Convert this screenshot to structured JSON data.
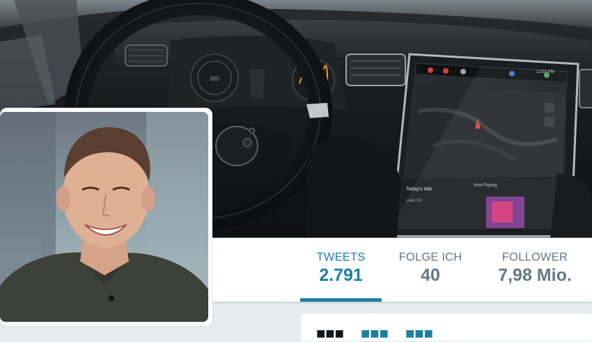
{
  "profile": {
    "avatar_alt": "",
    "header_image": "tesla-model-s-dashboard"
  },
  "nav": {
    "stats": [
      {
        "label": "TWEETS",
        "value": "2.791",
        "active": true
      },
      {
        "label": "FOLGE ICH",
        "value": "40",
        "active": false
      },
      {
        "label": "FOLLOWER",
        "value": "7,98 Mio.",
        "active": false
      }
    ]
  },
  "dashboard_screen": {
    "music_title": "Today's Hits",
    "now_playing": "Now Playing",
    "track": "Lean On",
    "clock": "12:53 PM"
  },
  "colors": {
    "accent": "#1b7fa3",
    "muted": "#657786",
    "page_bg": "#e6ecf0"
  }
}
